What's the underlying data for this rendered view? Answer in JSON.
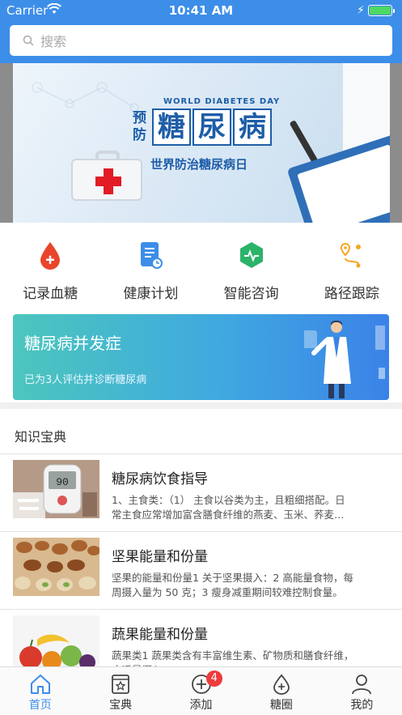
{
  "status_bar": {
    "carrier": "Carrier",
    "time": "10:41 AM"
  },
  "search": {
    "placeholder": "搜索"
  },
  "banner": {
    "en_title": "WORLD DIABETES DAY",
    "pre_text": "预防",
    "main_chars": [
      "糖",
      "尿",
      "病"
    ],
    "subtitle": "世界防治糖尿病日"
  },
  "quick_menu": [
    {
      "label": "记录血糖",
      "icon": "blood-drop-icon",
      "color": "#e8452c"
    },
    {
      "label": "健康计划",
      "icon": "plan-document-icon",
      "color": "#3d8ee8"
    },
    {
      "label": "智能咨询",
      "icon": "pulse-hexagon-icon",
      "color": "#2bb36a"
    },
    {
      "label": "路径跟踪",
      "icon": "route-pin-icon",
      "color": "#f5a623"
    }
  ],
  "promo": {
    "title": "糖尿病并发症",
    "subtitle": "已为3人评估并诊断糖尿病"
  },
  "knowledge": {
    "title": "知识宝典",
    "articles": [
      {
        "title": "糖尿病饮食指导",
        "desc": "1、主食类：（1） 主食以谷类为主，且粗细搭配。日常主食应常增加富含膳食纤维的燕麦、玉米、荞麦等粗粮。",
        "thumb": "glucose-meter"
      },
      {
        "title": "坚果能量和份量",
        "desc": "坚果的能量和份量1 关于坚果摄入：2 高能量食物，每周摄入量为 50 克；3 瘦身减重期间较难控制食量。",
        "thumb": "nuts"
      },
      {
        "title": "蔬果能量和份量",
        "desc": "蔬果类1 蔬果类含有丰富维生素、矿物质和膳食纤维，应适量摄入。",
        "thumb": "fruits"
      }
    ]
  },
  "tabbar": {
    "tabs": [
      {
        "label": "首页",
        "icon": "home-icon",
        "active": true
      },
      {
        "label": "宝典",
        "icon": "book-icon",
        "active": false
      },
      {
        "label": "添加",
        "icon": "add-circle-icon",
        "active": false,
        "badge": "4"
      },
      {
        "label": "糖圈",
        "icon": "drop-plus-icon",
        "active": false
      },
      {
        "label": "我的",
        "icon": "profile-icon",
        "active": false
      }
    ]
  },
  "colors": {
    "header_blue": "#3d8ee8",
    "badge_red": "#ee3b3b"
  }
}
